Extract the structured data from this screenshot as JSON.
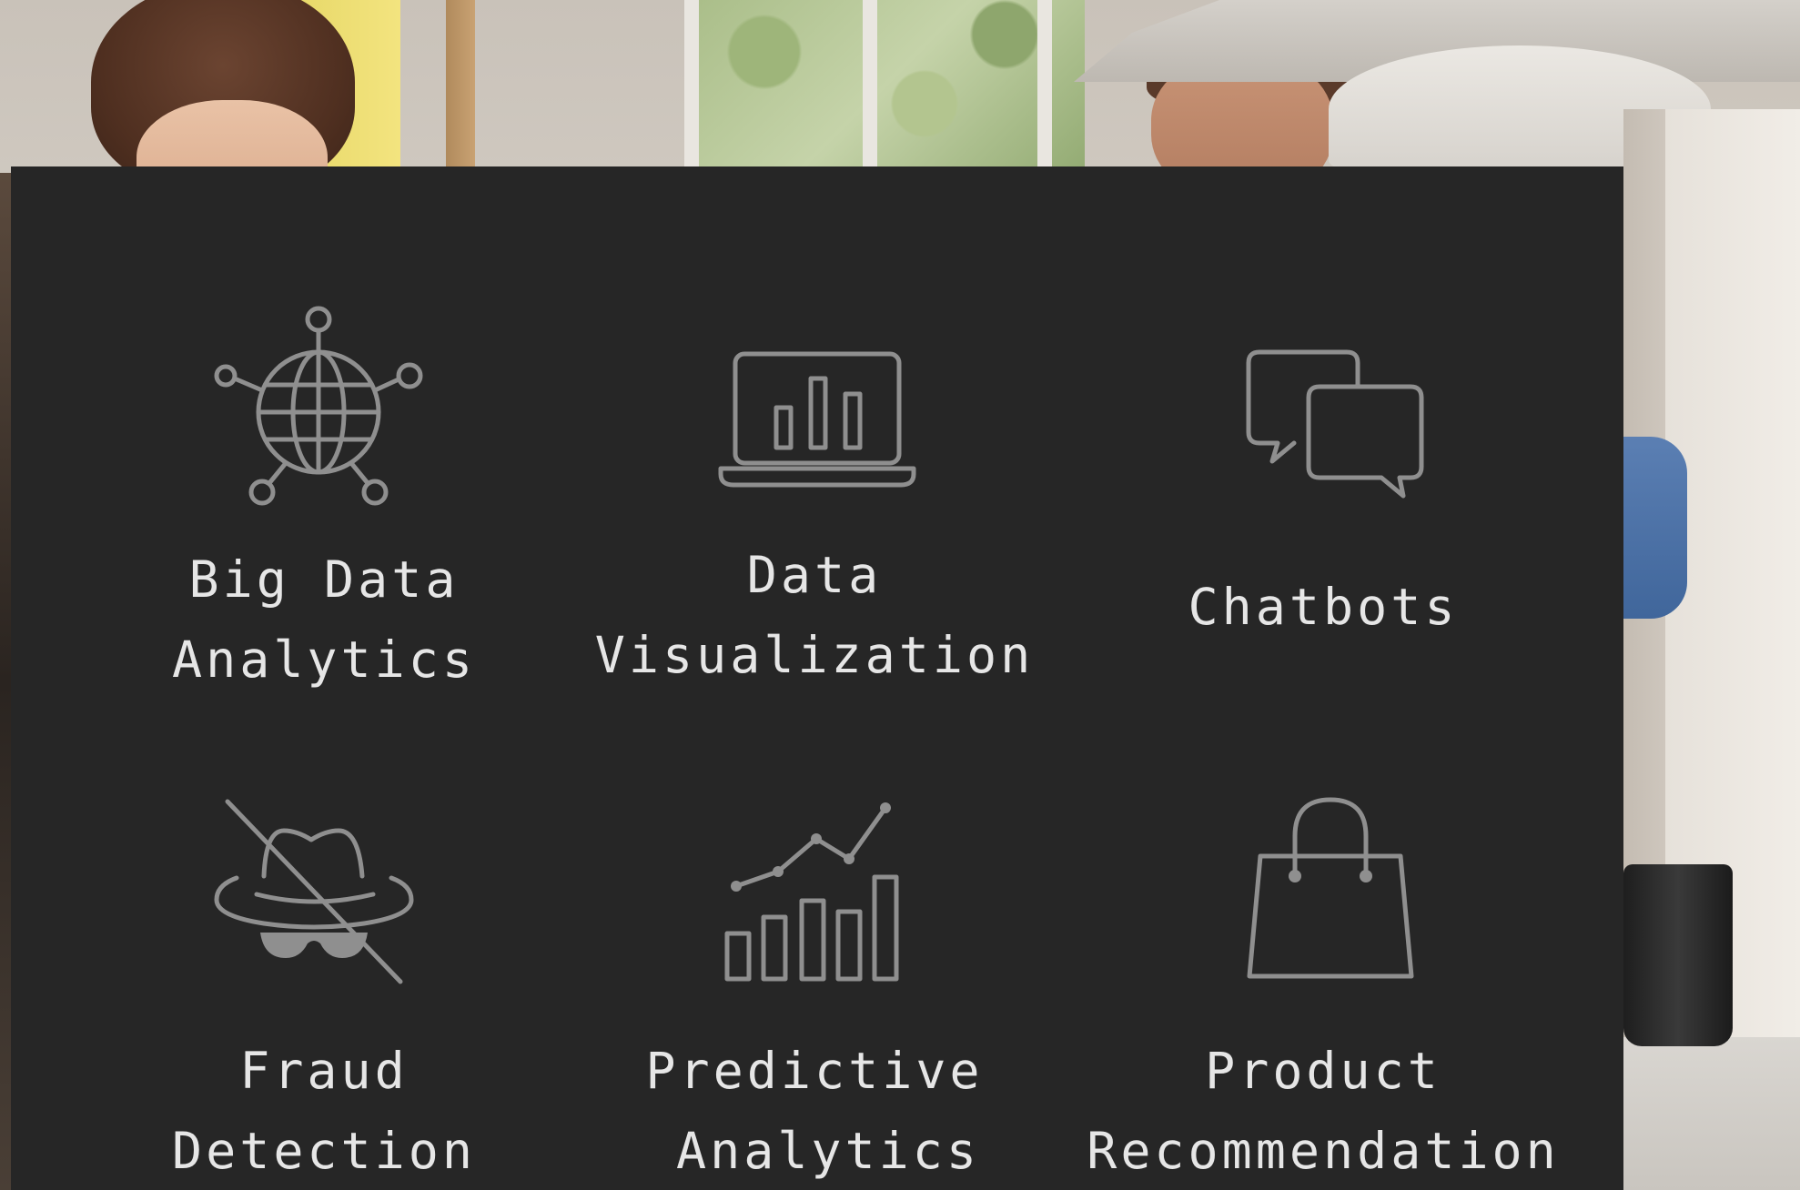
{
  "panel": {
    "background_color": "#262626",
    "icon_color": "#8f8f8f",
    "text_color": "#e6e6e6"
  },
  "services": [
    {
      "icon": "globe-network-icon",
      "label_line1": "Big Data",
      "label_line2": "Analytics"
    },
    {
      "icon": "laptop-bar-chart-icon",
      "label_line1": "Data",
      "label_line2": "Visualization"
    },
    {
      "icon": "chat-bubbles-icon",
      "label_line1": "Chatbots",
      "label_line2": ""
    },
    {
      "icon": "incognito-hat-crossed-icon",
      "label_line1": "Fraud",
      "label_line2": "Detection"
    },
    {
      "icon": "trend-bar-chart-icon",
      "label_line1": "Predictive",
      "label_line2": "Analytics"
    },
    {
      "icon": "shopping-bag-icon",
      "label_line1": "Product",
      "label_line2": "Recommendation"
    }
  ]
}
